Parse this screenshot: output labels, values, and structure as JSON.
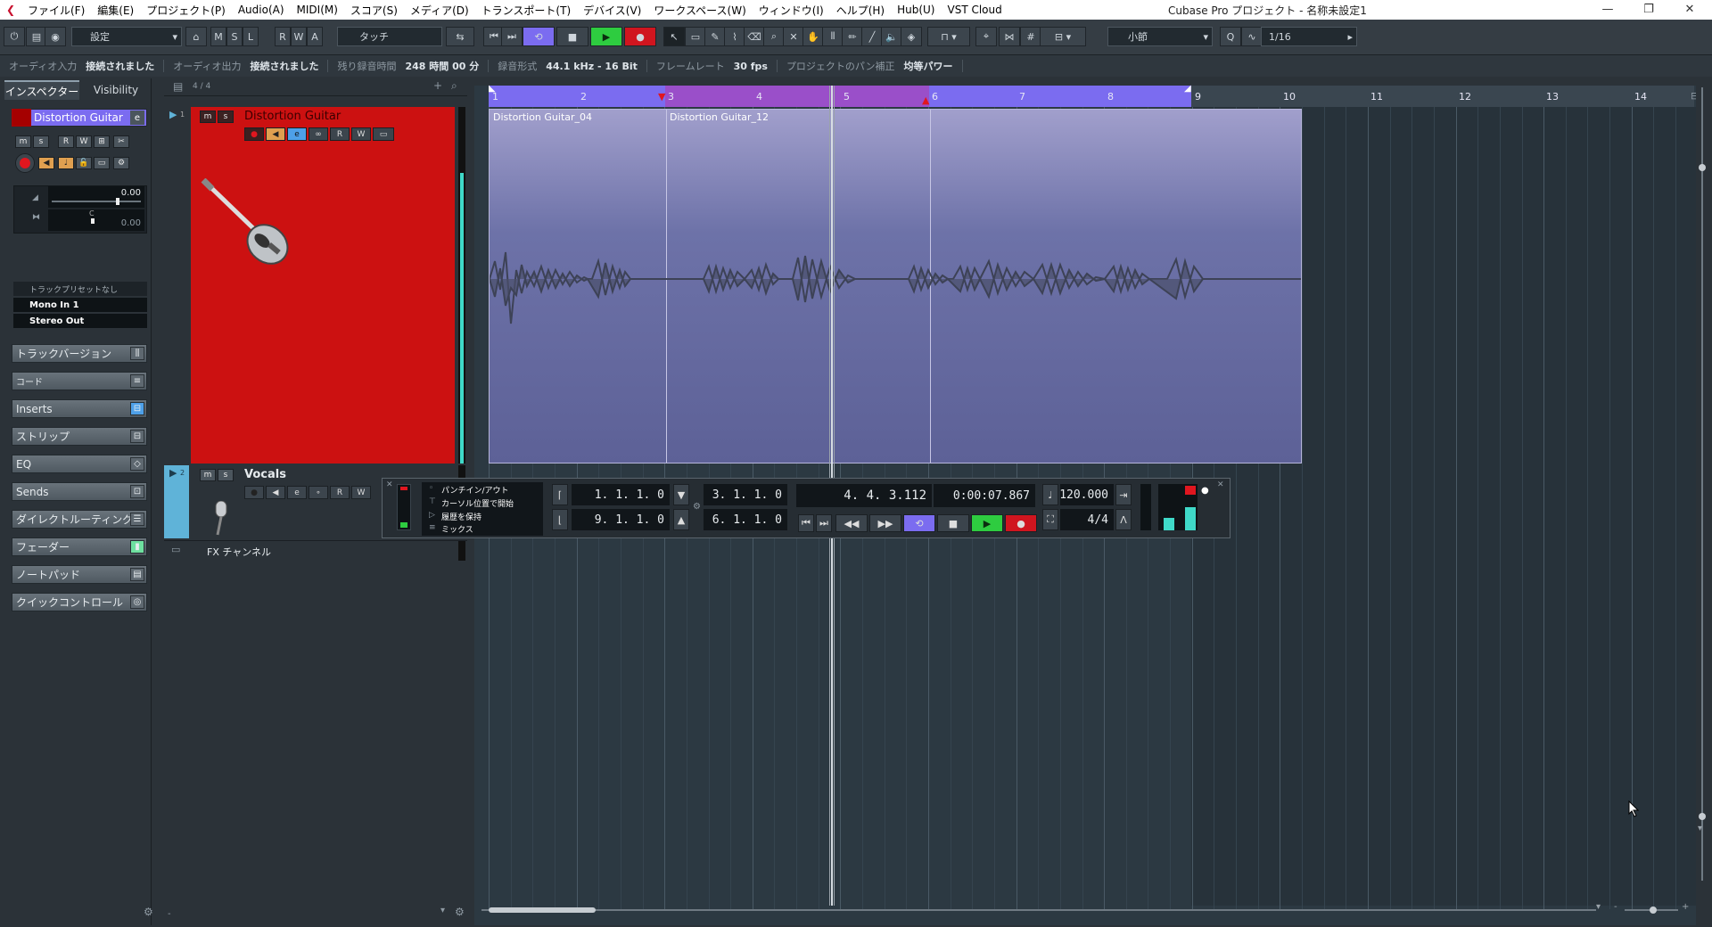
{
  "menu": {
    "items": [
      "ファイル(F)",
      "編集(E)",
      "プロジェクト(P)",
      "Audio(A)",
      "MIDI(M)",
      "スコア(S)",
      "メディア(D)",
      "トランスポート(T)",
      "デバイス(V)",
      "ワークスペース(W)",
      "ウィンドウ(I)",
      "ヘルプ(H)",
      "Hub(U)",
      "VST Cloud"
    ],
    "window_title": "Cubase Pro プロジェクト - 名称未設定1"
  },
  "toolbar": {
    "preset": "設定",
    "m": "M",
    "s": "S",
    "l": "L",
    "r": "R",
    "w": "W",
    "a": "A",
    "automation_mode": "タッチ",
    "grid_type": "小節",
    "quantize": "1/16"
  },
  "status": {
    "audio_in_label": "オーディオ入力",
    "audio_in_value": "接続されました",
    "audio_out_label": "オーディオ出力",
    "audio_out_value": "接続されました",
    "rec_time_label": "残り録音時間",
    "rec_time_value": "248 時間 00 分",
    "rec_format_label": "録音形式",
    "rec_format_value": "44.1 kHz - 16 Bit",
    "frame_rate_label": "フレームレート",
    "frame_rate_value": "30 fps",
    "pan_label": "プロジェクトのパン補正",
    "pan_value": "均等パワー"
  },
  "inspector": {
    "tab_inspector": "インスペクター",
    "tab_visibility": "Visibility",
    "track_name": "Distortion Guitar",
    "volume_value": "0.00",
    "pan_center": "C",
    "pan_value": "0.00",
    "preset": "トラックプリセットなし",
    "input": "Mono In 1",
    "output": "Stereo Out",
    "sections": [
      "トラックバージョン",
      "コード",
      "Inserts",
      "ストリップ",
      "EQ",
      "Sends",
      "ダイレクトルーティング",
      "フェーダー",
      "ノートパッド",
      "クイックコントロール"
    ]
  },
  "tracklist": {
    "count": "4 / 4",
    "tracks": [
      {
        "num": "1",
        "name": "Distortion Guitar",
        "color": "#cc1111"
      },
      {
        "num": "2",
        "name": "Vocals",
        "color": "#5fb3d8"
      },
      {
        "num": "",
        "name": "FX チャンネル",
        "color": "#2b3238"
      }
    ]
  },
  "ruler": {
    "bars": [
      "1",
      "2",
      "3",
      "4",
      "5",
      "6",
      "7",
      "8",
      "9",
      "10",
      "11",
      "12",
      "13",
      "14"
    ]
  },
  "events": [
    {
      "name": "Distortion Guitar_04"
    },
    {
      "name": "Distortion Guitar_12"
    }
  ],
  "transport": {
    "punch_in": "パンチイン/アウト",
    "cursor_start": "カーソル位置で開始",
    "keep_history": "履歴を保持",
    "mix": "ミックス",
    "left_locator": "1. 1. 1.  0",
    "right_locator": "9. 1. 1.  0",
    "loop_start": "3. 1. 1.  0",
    "loop_end": "6. 1. 1.  0",
    "position_bars": "4. 4. 3.112",
    "position_time": "0:00:07.867",
    "tempo": "120.000",
    "signature": "4/4"
  },
  "colors": {
    "accent": "#7b6cf0",
    "event_top": "#9b98c6",
    "event_bottom": "#5d6197",
    "record": "#d0151f",
    "play": "#2ecc40"
  }
}
